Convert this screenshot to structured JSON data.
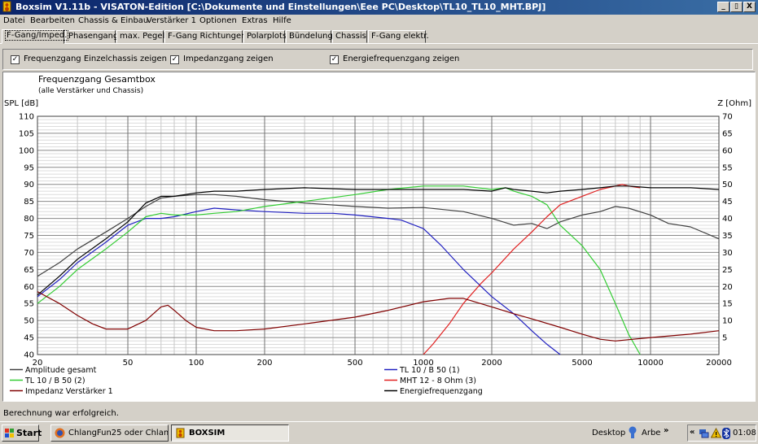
{
  "window": {
    "title": "Boxsim V1.11b - VISATON-Edition [C:\\Dokumente und Einstellungen\\Eee PC\\Desktop\\TL10_TL10_MHT.BPJ]",
    "buttons": [
      "_",
      "▯",
      "X"
    ]
  },
  "menu": [
    "Datei",
    "Bearbeiten",
    "Chassis & Einbau",
    "Verstärker 1",
    "Optionen",
    "Extras",
    "Hilfe"
  ],
  "tabs": [
    "F-Gang/Imped.",
    "Phasengang",
    "max. Pegel",
    "F-Gang Richtungen",
    "Polarplots",
    "Bündelung",
    "Chassis",
    "F-Gang elektr."
  ],
  "options": [
    {
      "label": "Frequenzgang Einzelchassis zeigen",
      "checked": true
    },
    {
      "label": "Impedanzgang zeigen",
      "checked": true
    },
    {
      "label": "Energiefrequenzgang zeigen",
      "checked": true
    }
  ],
  "chart_data": {
    "type": "line",
    "title": "Frequenzgang Gesamtbox",
    "subtitle": "(alle Verstärker und Chassis)",
    "ylabel": "SPL [dB]",
    "y2label": "Z [Ohm]",
    "xscale": "log",
    "xlim": [
      20,
      20000
    ],
    "ylim": [
      40,
      110
    ],
    "y2lim": [
      0,
      70
    ],
    "xticks": [
      20,
      50,
      100,
      200,
      500,
      1000,
      2000,
      5000,
      10000,
      20000
    ],
    "yticks": [
      40,
      45,
      50,
      55,
      60,
      65,
      70,
      75,
      80,
      85,
      90,
      95,
      100,
      105,
      110
    ],
    "y2ticks": [
      5,
      10,
      15,
      20,
      25,
      30,
      35,
      40,
      45,
      50,
      55,
      60,
      65,
      70
    ],
    "grid": true,
    "series": [
      {
        "name": "Amplitude gesamt",
        "color": "#404040",
        "axis": "left",
        "x": [
          20,
          25,
          30,
          40,
          50,
          60,
          70,
          80,
          100,
          120,
          150,
          200,
          300,
          500,
          700,
          1000,
          1500,
          2000,
          2500,
          3000,
          3500,
          4000,
          5000,
          6000,
          7000,
          8000,
          10000,
          12000,
          15000,
          20000
        ],
        "y": [
          63,
          67,
          71,
          76,
          80,
          83.5,
          86,
          86.5,
          87,
          87,
          86.5,
          85.5,
          84.5,
          83.5,
          83,
          83.2,
          82,
          80,
          78,
          78.5,
          77,
          79,
          81,
          82,
          83.5,
          83,
          81,
          78.5,
          77.5,
          74
        ]
      },
      {
        "name": "TL 10 / B 50 (1)",
        "color": "#2020c0",
        "axis": "left",
        "x": [
          20,
          25,
          30,
          40,
          50,
          60,
          70,
          80,
          100,
          120,
          150,
          200,
          300,
          400,
          500,
          700,
          800,
          1000,
          1200,
          1500,
          2000,
          2500,
          3000,
          3500,
          4000
        ],
        "y": [
          57,
          62,
          67,
          73,
          78,
          80,
          80,
          80.5,
          82,
          83,
          82.5,
          82,
          81.5,
          81.5,
          81,
          80,
          79.5,
          77,
          72,
          65,
          57,
          52,
          47,
          43,
          40
        ]
      },
      {
        "name": "TL 10 / B 50 (2)",
        "color": "#33cc33",
        "axis": "left",
        "x": [
          20,
          25,
          30,
          40,
          50,
          60,
          70,
          80,
          100,
          120,
          150,
          200,
          300,
          500,
          700,
          1000,
          1500,
          2000,
          2300,
          2500,
          3000,
          3500,
          4000,
          5000,
          6000,
          7000,
          8000,
          9000
        ],
        "y": [
          55,
          60,
          65,
          71,
          76,
          80.5,
          81.5,
          81,
          81,
          81.5,
          82,
          83.5,
          85,
          87,
          88.5,
          89.5,
          89.5,
          88.5,
          89,
          88,
          86.5,
          84,
          78,
          72,
          65,
          55,
          46,
          40
        ]
      },
      {
        "name": "MHT 12 - 8 Ohm (3)",
        "color": "#e02020",
        "axis": "left",
        "x": [
          1000,
          1100,
          1300,
          1500,
          1800,
          2000,
          2500,
          3000,
          3500,
          4000,
          5000,
          6000,
          7000,
          7500,
          8000,
          9000
        ],
        "y": [
          40,
          43,
          49,
          55,
          61,
          64,
          71,
          76,
          80.5,
          84,
          86.5,
          88.5,
          89.5,
          90,
          89.5,
          89
        ]
      },
      {
        "name": "Impedanz Verstärker 1",
        "color": "#800000",
        "axis": "right",
        "x": [
          20,
          25,
          30,
          35,
          40,
          50,
          60,
          70,
          75,
          80,
          90,
          100,
          120,
          150,
          200,
          300,
          500,
          700,
          1000,
          1300,
          1500,
          2000,
          2500,
          3000,
          4000,
          5000,
          6000,
          7000,
          10000,
          15000,
          20000
        ],
        "y": [
          18.5,
          15,
          11.5,
          9,
          7.5,
          7.5,
          10,
          14,
          14.5,
          13,
          10,
          8,
          7,
          7,
          7.5,
          9,
          11,
          13,
          15.5,
          16.5,
          16.5,
          14,
          12,
          10.5,
          8,
          6,
          4.5,
          4,
          5,
          6,
          7
        ]
      },
      {
        "name": "Energiefrequenzgang",
        "color": "#000000",
        "axis": "left",
        "x": [
          20,
          25,
          30,
          40,
          50,
          60,
          70,
          80,
          100,
          120,
          150,
          200,
          300,
          500,
          700,
          1000,
          1500,
          2000,
          2300,
          2500,
          3000,
          3500,
          4000,
          5000,
          6000,
          7000,
          8000,
          10000,
          15000,
          20000
        ],
        "y": [
          57.5,
          63,
          68,
          74,
          79,
          84.5,
          86.5,
          86.5,
          87.5,
          88,
          88,
          88.5,
          89,
          88.5,
          88.5,
          88.5,
          88.5,
          88,
          89,
          88.5,
          88,
          87.5,
          88,
          88.5,
          89,
          89.5,
          89.5,
          89,
          89,
          88.5
        ]
      }
    ]
  },
  "status": "Berechnung war erfolgreich.",
  "taskbar": {
    "start": "Start",
    "items": [
      {
        "label": "ChlangFun25 oder Chlan...",
        "active": false
      },
      {
        "label": "BOXSIM",
        "active": true
      }
    ],
    "desktop": "Desktop",
    "arbe": "Arbe",
    "chevron": "»",
    "collapse": "«",
    "time": "01:08"
  }
}
